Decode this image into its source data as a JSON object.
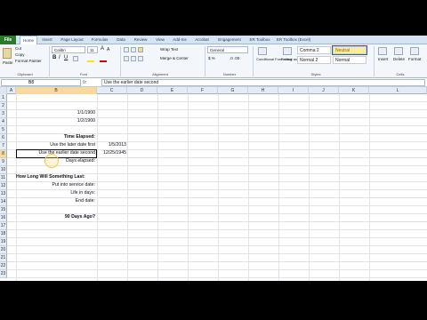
{
  "ribbon": {
    "file_tab": "File",
    "tabs": [
      "Home",
      "Insert",
      "Page Layout",
      "Formulas",
      "Data",
      "Review",
      "View",
      "Add-Ins",
      "Acrobat",
      "Engagement",
      "ER Toolbox",
      "ER Toolbox (Excel)"
    ],
    "active_tab": "Home",
    "clipboard": {
      "cut": "Cut",
      "copy": "Copy",
      "format_painter": "Format Painter",
      "paste": "Paste",
      "label": "Clipboard"
    },
    "font": {
      "name": "Calibri",
      "size": "11",
      "label": "Font"
    },
    "alignment": {
      "wrap_text": "Wrap Text",
      "merge_center": "Merge & Center",
      "label": "Alignment"
    },
    "number": {
      "format": "General",
      "label": "Number"
    },
    "styles": {
      "conditional_formatting": "Conditional Formatting",
      "format_as_table": "Format as Table",
      "cells": [
        "Comma 2",
        "Neutral",
        "Normal 2",
        "Normal"
      ],
      "selected_cell": "Neutral",
      "label": "Styles"
    },
    "cells_group": {
      "insert": "Insert",
      "delete": "Delete",
      "format": "Format",
      "label": "Cells"
    }
  },
  "formula_bar": {
    "name_box": "B8",
    "fx": "fx",
    "formula": "Use the earlier date second"
  },
  "grid": {
    "columns": [
      "A",
      "B",
      "C",
      "D",
      "E",
      "F",
      "G",
      "H",
      "I",
      "J",
      "K",
      "L"
    ],
    "selected_column": "B",
    "rows": [
      "1",
      "2",
      "3",
      "4",
      "5",
      "6",
      "7",
      "8",
      "9",
      "10",
      "11",
      "12",
      "13",
      "14",
      "15",
      "16",
      "17",
      "18",
      "19",
      "20",
      "21",
      "22",
      "23"
    ],
    "selected_row": "8",
    "cells": {
      "b3": "1/1/1900",
      "b4": "1/2/1900",
      "b6": "Time Elapsed:",
      "b7": "Use the later date first",
      "c7": "1/5/2013",
      "b8": "Use the earlier date second",
      "c8": "12/25/1945",
      "b9": "Days elapsed:",
      "a11": "How Long Will Something Last:",
      "b12": "Put into service date:",
      "b13": "Life in days:",
      "b14": "End date:",
      "b16": "90 Days Ago?"
    }
  }
}
